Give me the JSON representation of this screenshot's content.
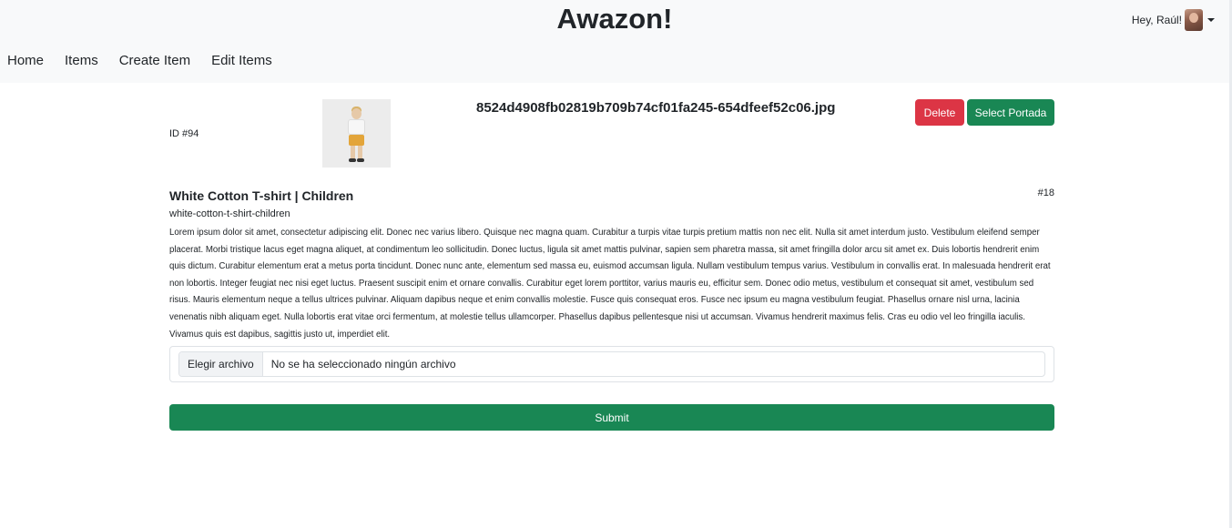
{
  "header": {
    "brand": "Awazon!",
    "greeting": "Hey, Raúl!"
  },
  "nav": {
    "items": [
      {
        "label": "Home"
      },
      {
        "label": "Items"
      },
      {
        "label": "Create Item"
      },
      {
        "label": "Edit Items"
      }
    ]
  },
  "image": {
    "id_label": "ID #94",
    "filename": "8524d4908fb02819b709b74cf01fa245-654dfeef52c06.jpg",
    "delete_label": "Delete",
    "portada_label": "Select Portada"
  },
  "product": {
    "title": "White Cotton T-shirt | Children",
    "number": "#18",
    "slug": "white-cotton-t-shirt-children",
    "description": "Lorem ipsum dolor sit amet, consectetur adipiscing elit. Donec nec varius libero. Quisque nec magna quam. Curabitur a turpis vitae turpis pretium mattis non nec elit. Nulla sit amet interdum justo. Vestibulum eleifend semper placerat. Morbi tristique lacus eget magna aliquet, at condimentum leo sollicitudin. Donec luctus, ligula sit amet mattis pulvinar, sapien sem pharetra massa, sit amet fringilla dolor arcu sit amet ex. Duis lobortis hendrerit enim quis dictum. Curabitur elementum erat a metus porta tincidunt. Donec nunc ante, elementum sed massa eu, euismod accumsan ligula. Nullam vestibulum tempus varius. Vestibulum in convallis erat. In malesuada hendrerit erat non lobortis. Integer feugiat nec nisi eget luctus. Praesent suscipit enim et ornare convallis. Curabitur eget lorem porttitor, varius mauris eu, efficitur sem. Donec odio metus, vestibulum et consequat sit amet, vestibulum sed risus. Mauris elementum neque a tellus ultrices pulvinar. Aliquam dapibus neque et enim convallis molestie. Fusce quis consequat eros. Fusce nec ipsum eu magna vestibulum feugiat. Phasellus ornare nisl urna, lacinia venenatis nibh aliquam eget. Nulla lobortis erat vitae orci fermentum, at molestie tellus ullamcorper. Phasellus dapibus pellentesque nisi ut accumsan. Vivamus hendrerit maximus felis. Cras eu odio vel leo fringilla iaculis. Vivamus quis est dapibus, sagittis justo ut, imperdiet elit."
  },
  "upload": {
    "choose_label": "Elegir archivo",
    "status": "No se ha seleccionado ningún archivo"
  },
  "form": {
    "submit_label": "Submit"
  },
  "colors": {
    "navbar_bg": "#f8f9fa",
    "danger": "#dc3545",
    "success": "#198754"
  },
  "icons": {
    "avatar": "user-avatar",
    "dropdown": "caret-down-icon"
  }
}
